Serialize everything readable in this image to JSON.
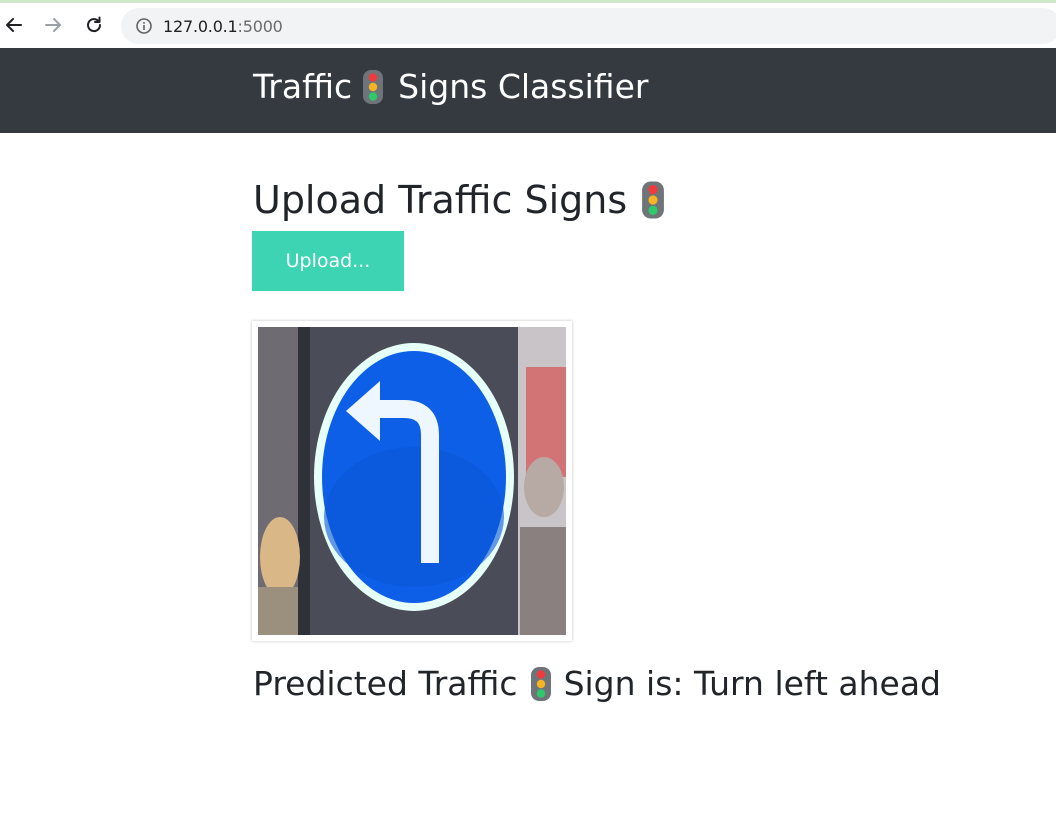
{
  "browser": {
    "url_host": "127.0.0.1",
    "url_port": ":5000"
  },
  "navbar": {
    "brand_part1": "Traffic",
    "brand_part2": "Signs Classifier"
  },
  "main": {
    "heading": "Upload Traffic Signs",
    "upload_button_label": "Upload...",
    "prediction_part1": "Predicted Traffic",
    "prediction_part2": "Sign is: Turn left ahead"
  },
  "colors": {
    "navbar_bg": "#343a40",
    "upload_button_bg": "#3dd4b3",
    "sign_blue": "#0e5fe8"
  },
  "icons": {
    "back": "arrow-left-icon",
    "forward": "arrow-right-icon",
    "reload": "reload-icon",
    "info": "info-icon",
    "traffic_light": "traffic-light-icon"
  }
}
